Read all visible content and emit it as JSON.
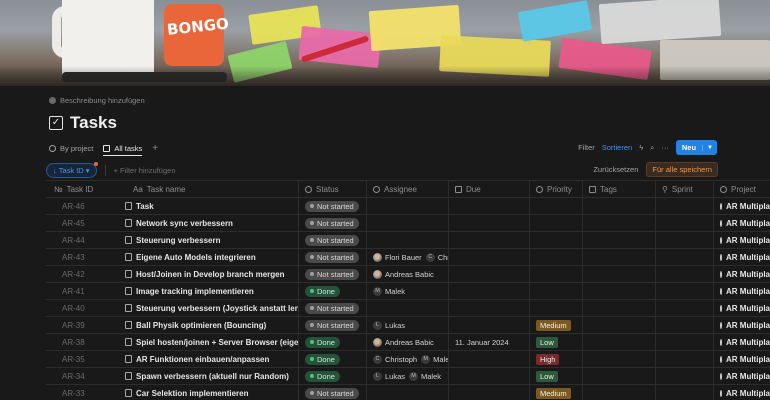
{
  "cover": {
    "mug_text": "BONGO"
  },
  "page": {
    "description_link": "Beschreibung hinzufügen",
    "title": "Tasks"
  },
  "tabs": [
    {
      "label": "By project"
    },
    {
      "label": "All tasks"
    }
  ],
  "toolbar": {
    "filter": "Filter",
    "sort": "Sortieren",
    "new_label": "Neu"
  },
  "filterbar": {
    "sort_pill": "Task ID",
    "add_filter": "Filter hinzufügen",
    "reset": "Zurücksetzen",
    "save_all": "Für alle speichern"
  },
  "columns": {
    "id": "Task ID",
    "name": "Task name",
    "status": "Status",
    "assignee": "Assignee",
    "due": "Due",
    "priority": "Priority",
    "tags": "Tags",
    "sprint": "Sprint",
    "project": "Project"
  },
  "rows": [
    {
      "id": "AR-46",
      "name": "Task",
      "status": "Not started",
      "status_type": "ns",
      "assignees": [],
      "due": "",
      "priority": "",
      "project": "AR Multipla"
    },
    {
      "id": "AR-45",
      "name": "Network sync verbessern",
      "status": "Not started",
      "status_type": "ns",
      "assignees": [],
      "due": "",
      "priority": "",
      "project": "AR Multipla"
    },
    {
      "id": "AR-44",
      "name": "Steuerung verbessern",
      "status": "Not started",
      "status_type": "ns",
      "assignees": [],
      "due": "",
      "priority": "",
      "project": "AR Multipla"
    },
    {
      "id": "AR-43",
      "name": "Eigene Auto Models integrieren",
      "status": "Not started",
      "status_type": "ns",
      "assignees": [
        {
          "name": "Flori Bauer",
          "initial": "",
          "img": true
        },
        {
          "name": "Chri",
          "initial": "C",
          "img": false
        }
      ],
      "due": "",
      "priority": "",
      "project": "AR Multipla"
    },
    {
      "id": "AR-42",
      "name": "Host/Joinen in Develop branch mergen",
      "status": "Not started",
      "status_type": "ns",
      "assignees": [
        {
          "name": "Andreas Babic",
          "initial": "",
          "img": true
        }
      ],
      "due": "",
      "priority": "",
      "project": "AR Multipla"
    },
    {
      "id": "AR-41",
      "name": "Image tracking implementieren",
      "status": "Done",
      "status_type": "done",
      "assignees": [
        {
          "name": "Malek",
          "initial": "M",
          "img": false
        }
      ],
      "due": "",
      "priority": "",
      "project": "AR Multipla"
    },
    {
      "id": "AR-40",
      "name": "Steuerung verbessern (Joystick anstatt lenkrad",
      "status": "Not started",
      "status_type": "ns",
      "assignees": [],
      "due": "",
      "priority": "",
      "project": "AR Multipla"
    },
    {
      "id": "AR-39",
      "name": "Ball Physik optimieren (Bouncing)",
      "status": "Not started",
      "status_type": "ns",
      "assignees": [
        {
          "name": "Lukas",
          "initial": "L",
          "img": false
        }
      ],
      "due": "",
      "priority": "Medium",
      "project": "AR Multipla"
    },
    {
      "id": "AR-38",
      "name": "Spiel hosten/joinen + Server Browser (eigene S",
      "status": "Done",
      "status_type": "done",
      "assignees": [
        {
          "name": "Andreas Babic",
          "initial": "",
          "img": true
        }
      ],
      "due": "11. Januar 2024",
      "priority": "Low",
      "project": "AR Multipla"
    },
    {
      "id": "AR-35",
      "name": "AR Funktionen einbauen/anpassen",
      "status": "Done",
      "status_type": "done",
      "assignees": [
        {
          "name": "Christoph",
          "initial": "C",
          "img": false
        },
        {
          "name": "Male",
          "initial": "M",
          "img": false
        }
      ],
      "due": "",
      "priority": "High",
      "project": "AR Multipla"
    },
    {
      "id": "AR-34",
      "name": "Spawn verbessern (aktuell nur Random)",
      "status": "Done",
      "status_type": "done",
      "assignees": [
        {
          "name": "Lukas",
          "initial": "L",
          "img": false
        },
        {
          "name": "Malek",
          "initial": "M",
          "img": false
        }
      ],
      "due": "",
      "priority": "Low",
      "project": "AR Multipla"
    },
    {
      "id": "AR-33",
      "name": "Car Selektion implementieren",
      "status": "Not started",
      "status_type": "ns",
      "assignees": [],
      "due": "",
      "priority": "Medium",
      "project": "AR Multipla"
    }
  ]
}
